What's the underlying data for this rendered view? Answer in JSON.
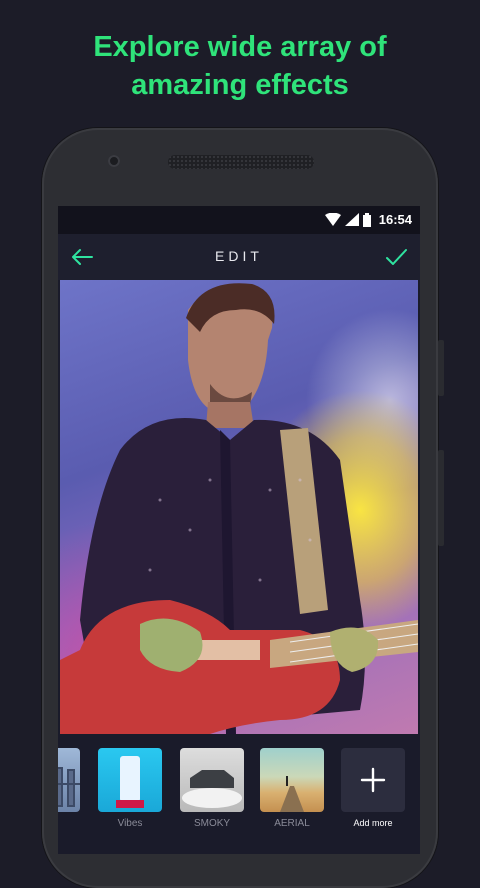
{
  "headline": {
    "line1": "Explore wide array of",
    "line2": "amazing effects"
  },
  "status_bar": {
    "time": "16:54",
    "icons": [
      "wifi-icon",
      "signal-icon",
      "battery-icon"
    ]
  },
  "app_bar": {
    "title": "EDIT",
    "back_icon": "arrow-left-icon",
    "confirm_icon": "check-icon",
    "accent_color": "#2fe3a0"
  },
  "filters": [
    {
      "label": "",
      "thumb": "city-bridge"
    },
    {
      "label": "Vibes",
      "thumb": "cyan-tower"
    },
    {
      "label": "SMOKY",
      "thumb": "car-smoke"
    },
    {
      "label": "AERIAL",
      "thumb": "desert-road"
    }
  ],
  "add_more": {
    "label": "Add more",
    "icon": "plus-icon"
  },
  "colors": {
    "headline": "#2fe37a",
    "background": "#1c1c28",
    "screen": "#1a1b2a"
  }
}
